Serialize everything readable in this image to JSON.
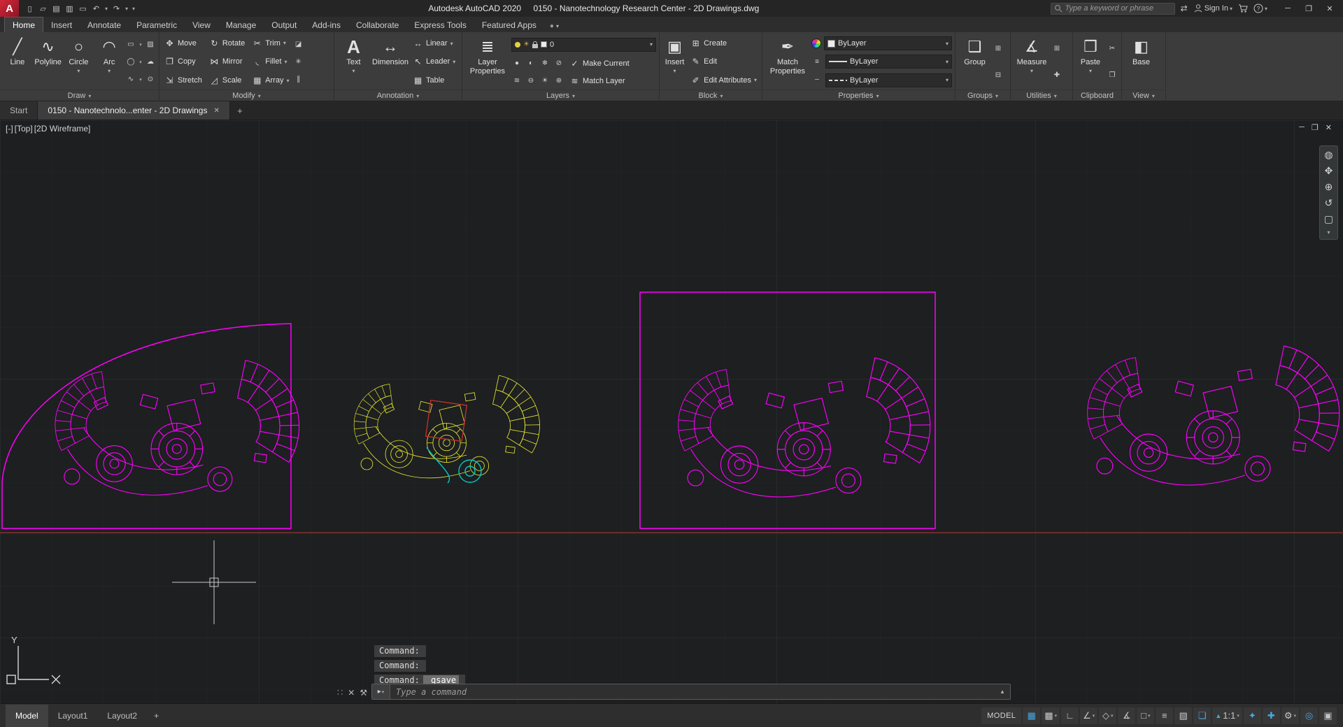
{
  "titlebar": {
    "app_title": "Autodesk AutoCAD 2020",
    "doc_title": "0150 - Nanotechnology Research Center - 2D Drawings.dwg",
    "search_placeholder": "Type a keyword or phrase",
    "sign_in": "Sign In"
  },
  "menu": {
    "tabs": [
      "Home",
      "Insert",
      "Annotate",
      "Parametric",
      "View",
      "Manage",
      "Output",
      "Add-ins",
      "Collaborate",
      "Express Tools",
      "Featured Apps"
    ]
  },
  "ribbon": {
    "draw": {
      "title": "Draw",
      "line": "Line",
      "polyline": "Polyline",
      "circle": "Circle",
      "arc": "Arc"
    },
    "modify": {
      "title": "Modify",
      "move": "Move",
      "copy": "Copy",
      "stretch": "Stretch",
      "rotate": "Rotate",
      "mirror": "Mirror",
      "scale": "Scale",
      "trim": "Trim",
      "fillet": "Fillet",
      "array": "Array"
    },
    "annotation": {
      "title": "Annotation",
      "text": "Text",
      "dimension": "Dimension",
      "linear": "Linear",
      "leader": "Leader",
      "table": "Table"
    },
    "layers": {
      "title": "Layers",
      "layer_properties": "Layer Properties",
      "current_layer": "0",
      "make_current": "Make Current",
      "match_layer": "Match Layer"
    },
    "block": {
      "title": "Block",
      "insert": "Insert",
      "create": "Create",
      "edit": "Edit",
      "edit_attributes": "Edit Attributes"
    },
    "properties": {
      "title": "Properties",
      "match_properties": "Match Properties",
      "color": "ByLayer",
      "lineweight": "ByLayer",
      "linetype": "ByLayer"
    },
    "groups": {
      "title": "Groups",
      "group": "Group"
    },
    "utilities": {
      "title": "Utilities",
      "measure": "Measure"
    },
    "clipboard": {
      "title": "Clipboard",
      "paste": "Paste"
    },
    "view": {
      "title": "View",
      "base": "Base"
    }
  },
  "file_tabs": {
    "start": "Start",
    "document": "0150 - Nanotechnolo...enter - 2D Drawings",
    "new_tab": "+"
  },
  "viewport": {
    "vp_minus": "[-]",
    "vp_view": "[Top]",
    "vp_visual": "[2D Wireframe]",
    "ucs_y": "Y"
  },
  "command": {
    "line1": "Command:",
    "line2": "Command:",
    "line3": "Command:",
    "qsave_token": "_qsave",
    "placeholder": "Type a command"
  },
  "statusbar": {
    "model_tab": "Model",
    "layout1_tab": "Layout1",
    "layout2_tab": "Layout2",
    "new_layout": "+",
    "model_badge": "MODEL",
    "scale_label": "1:1"
  },
  "colors": {
    "magenta": "#ff00ff",
    "yellow": "#e6e632",
    "cyan": "#00cccc",
    "red": "#c03030",
    "accent_blue": "#47a8e0",
    "logo_red": "#d3273a"
  },
  "glyphs": {
    "logo": "A",
    "qnew": "▯",
    "qopen": "▱",
    "qsave": "▤",
    "qsaveas": "▥",
    "qplot": "▭",
    "undo": "↶",
    "redo": "↷",
    "dropdown": "▾",
    "dropup": "▴",
    "prompt": "▸",
    "minimize": "─",
    "restore": "❐",
    "close": "✕",
    "cloud": "●",
    "exchange": "⇄",
    "help_q": "?",
    "line": "╱",
    "polyline": "∿",
    "circle": "○",
    "arc": "◠",
    "rect_tool": "▭",
    "hatch": "▨",
    "ellipse": "◯",
    "revcloud": "☁",
    "spline": "∿",
    "point": "⊙",
    "move": "✥",
    "copy": "❐",
    "stretch": "⇲",
    "rotate": "↻",
    "mirror": "⋈",
    "scale": "◿",
    "trim": "✂",
    "fillet": "◟",
    "array": "▦",
    "erase": "◪",
    "explode": "✳",
    "offset": "∥",
    "text": "A",
    "dimension": "↔",
    "linear": "↔",
    "leader": "↖",
    "table": "▦",
    "layerprops": "≣",
    "sun": "☀",
    "makecurrent": "✓",
    "matchlayer": "≋",
    "layer_tools_row1": [
      "●",
      "◐",
      "❄",
      "⊘"
    ],
    "layer_tools_row2": [
      "≋",
      "⊖",
      "☀",
      "⊕"
    ],
    "insert": "▣",
    "create": "⊞",
    "edit": "✎",
    "editattr": "✐",
    "matchprops": "✒",
    "lineweight": "≡",
    "linetype": "┄",
    "group": "❑",
    "groupedit": "⊞",
    "ungroup": "⊟",
    "measure": "∡",
    "quickcalc": "⊞",
    "idpoint": "✚",
    "paste": "❒",
    "cut": "✂",
    "copyclip": "❐",
    "base": "◧",
    "navwheel": "◍",
    "pan": "✥",
    "zoomnav": "⊕",
    "orbit": "↺",
    "showmotion": "▢",
    "grip": "∷",
    "wrench": "⚒",
    "grid": "▦",
    "snap": "▩",
    "ortho": "∟",
    "polar": "∠",
    "iso": "◇",
    "otrack": "∡",
    "osnap": "□",
    "lwt": "≡",
    "transp": "▨",
    "selcycle": "❏",
    "annovis": "✦",
    "autoscale": "✚",
    "gear": "⚙",
    "isolate": "◎",
    "cleanscreen": "▣",
    "scaletri": "▲"
  }
}
